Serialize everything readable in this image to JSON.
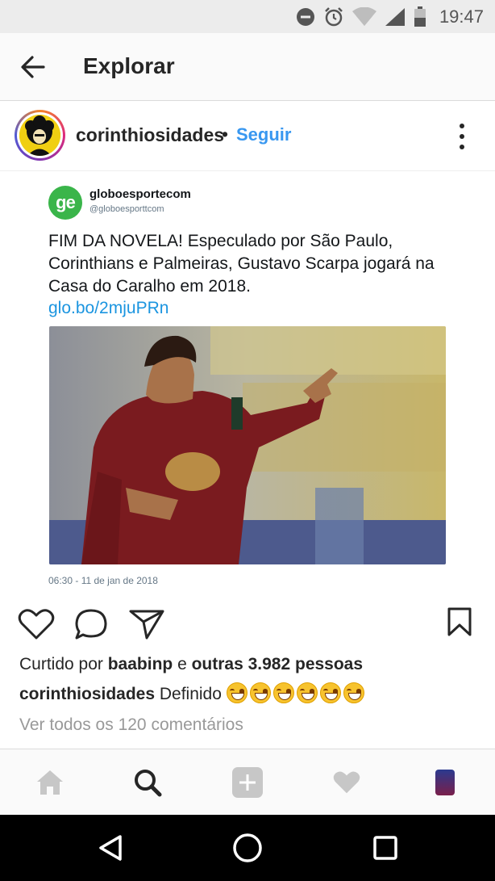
{
  "status_bar": {
    "time": "19:47",
    "icons": [
      "do-not-disturb-icon",
      "alarm-icon",
      "wifi-icon",
      "signal-icon",
      "battery-icon"
    ]
  },
  "top_nav": {
    "title": "Explorar",
    "back_icon": "arrow-left-icon"
  },
  "post": {
    "username": "corinthiosidades",
    "separator": "•",
    "follow_label": "Seguir",
    "more_icon": "more-vertical-icon",
    "embedded_tweet": {
      "logo_text": "ge",
      "account_name": "globoesportecom",
      "account_handle": "@globoesporttcom",
      "text": "FIM DA NOVELA! Especulado por São Paulo, Corinthians e Palmeiras, Gustavo Scarpa jogará na Casa do Caralho em 2018.",
      "link": "glo.bo/2mjuPRn",
      "timestamp": "06:30 - 11 de jan de 2018"
    },
    "actions": {
      "like_icon": "heart-icon",
      "comment_icon": "comment-icon",
      "share_icon": "send-icon",
      "save_icon": "bookmark-icon"
    },
    "likes": {
      "prefix": "Curtido por ",
      "user": "baabinp",
      "middle": " e ",
      "others": "outras 3.982 pessoas"
    },
    "caption": {
      "user": "corinthiosidades",
      "text": " Definido ",
      "emoji_count": 6
    },
    "view_comments": "Ver todos os 120 comentários"
  },
  "tab_bar": {
    "items": [
      "home-icon",
      "search-icon",
      "add-icon",
      "heart-icon",
      "profile-icon"
    ],
    "active": "search-icon"
  },
  "android_nav": {
    "items": [
      "back-icon",
      "home-icon",
      "recents-icon"
    ]
  },
  "colors": {
    "accent": "#3897f0",
    "tweet_link": "#1b95e0",
    "ge_green": "#3ab54a"
  }
}
